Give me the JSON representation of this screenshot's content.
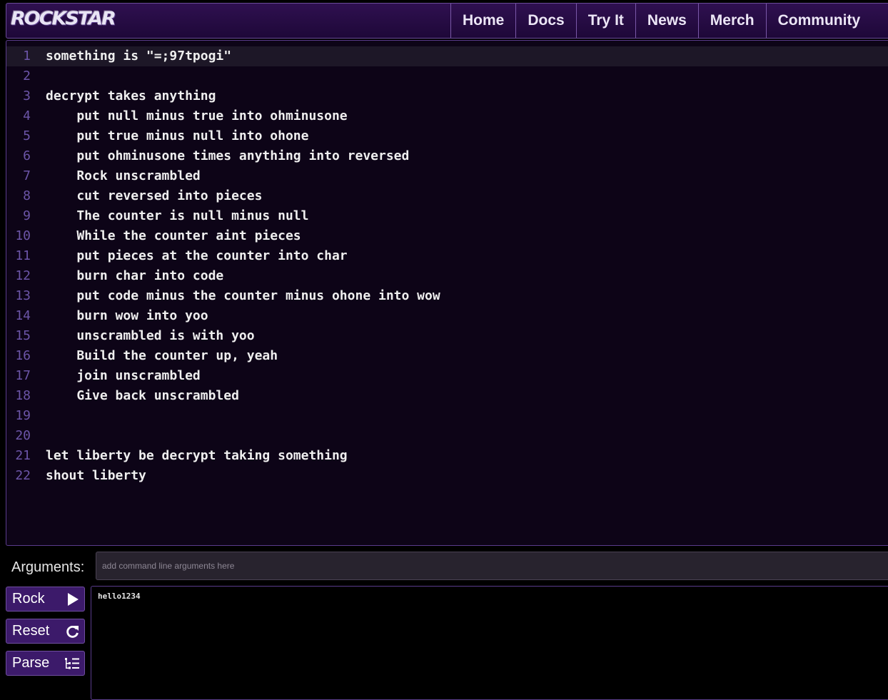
{
  "header": {
    "logo_text": "ROCKSTAR",
    "nav": [
      "Home",
      "Docs",
      "Try It",
      "News",
      "Merch",
      "Community"
    ]
  },
  "editor": {
    "lines": [
      {
        "num": "1",
        "text": "something is \"=;97tpogi\""
      },
      {
        "num": "2",
        "text": ""
      },
      {
        "num": "3",
        "text": "decrypt takes anything"
      },
      {
        "num": "4",
        "text": "    put null minus true into ohminusone"
      },
      {
        "num": "5",
        "text": "    put true minus null into ohone"
      },
      {
        "num": "6",
        "text": "    put ohminusone times anything into reversed"
      },
      {
        "num": "7",
        "text": "    Rock unscrambled"
      },
      {
        "num": "8",
        "text": "    cut reversed into pieces"
      },
      {
        "num": "9",
        "text": "    The counter is null minus null"
      },
      {
        "num": "10",
        "text": "    While the counter aint pieces"
      },
      {
        "num": "11",
        "text": "    put pieces at the counter into char"
      },
      {
        "num": "12",
        "text": "    burn char into code"
      },
      {
        "num": "13",
        "text": "    put code minus the counter minus ohone into wow"
      },
      {
        "num": "14",
        "text": "    burn wow into yoo"
      },
      {
        "num": "15",
        "text": "    unscrambled is with yoo"
      },
      {
        "num": "16",
        "text": "    Build the counter up, yeah"
      },
      {
        "num": "17",
        "text": "    join unscrambled"
      },
      {
        "num": "18",
        "text": "    Give back unscrambled"
      },
      {
        "num": "19",
        "text": ""
      },
      {
        "num": "20",
        "text": ""
      },
      {
        "num": "21",
        "text": "let liberty be decrypt taking something"
      },
      {
        "num": "22",
        "text": "shout liberty"
      }
    ]
  },
  "arguments": {
    "label": "Arguments:",
    "value": "",
    "placeholder": "add command line arguments here"
  },
  "buttons": {
    "rock": {
      "label": "Rock",
      "icon": "play-icon"
    },
    "reset": {
      "label": "Reset",
      "icon": "refresh-icon"
    },
    "parse": {
      "label": "Parse",
      "icon": "tree-list-icon"
    }
  },
  "output": {
    "text": "hello1234"
  },
  "colors": {
    "accent": "#3c1a6a",
    "line_number": "#6c55a8",
    "editor_bg": "#0d0417"
  }
}
